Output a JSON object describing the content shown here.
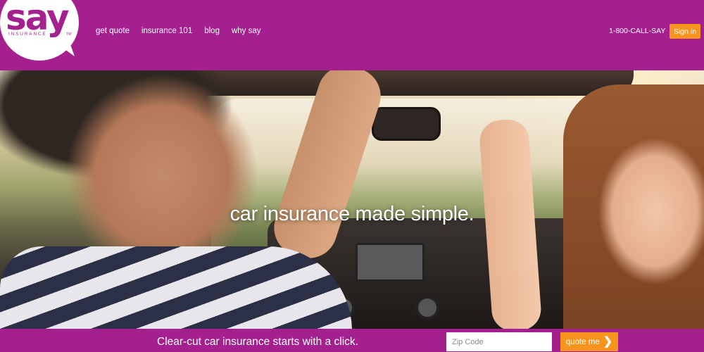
{
  "brand": {
    "name": "say",
    "sub": "INSURANCE",
    "tm": "TM",
    "color": "#a4208f",
    "accent": "#f7941d"
  },
  "nav": {
    "items": [
      {
        "label": "get quote"
      },
      {
        "label": "insurance 101"
      },
      {
        "label": "blog"
      },
      {
        "label": "why say"
      }
    ]
  },
  "header": {
    "phone": "1-800-CALL-SAY",
    "signin_label": "Sign in"
  },
  "hero": {
    "tagline": "car insurance made simple."
  },
  "footer_bar": {
    "text": "Clear-cut car insurance starts with a click.",
    "zip_placeholder": "Zip Code",
    "quote_label": "quote me",
    "quote_icon": "chevron-right-icon"
  }
}
